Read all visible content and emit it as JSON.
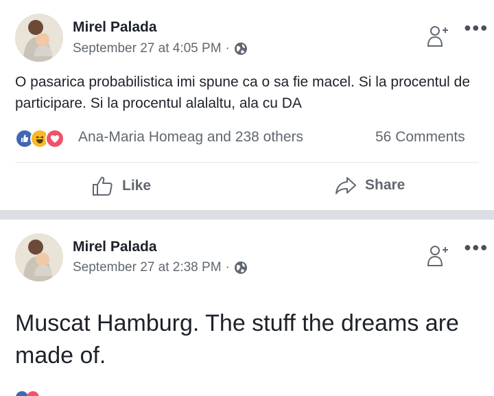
{
  "posts": [
    {
      "author": "Mirel Palada",
      "timestamp": "September 27 at 4:05 PM",
      "separator": "·",
      "privacy_icon": "globe-icon",
      "text": "O pasarica probabilistica imi spune ca o sa fie macel. Si la procentul de participare. Si la procentul alalaltu, ala cu DA",
      "reactions": [
        "like-icon",
        "haha-icon",
        "love-icon"
      ],
      "reactors": "Ana-Maria Homeag and 238 others",
      "comments": "56 Comments",
      "actions": {
        "like": "Like",
        "share": "Share"
      }
    },
    {
      "author": "Mirel Palada",
      "timestamp": "September 27 at 2:38 PM",
      "separator": "·",
      "privacy_icon": "globe-icon",
      "text": "Muscat Hamburg. The stuff the dreams are made of."
    }
  ],
  "colors": {
    "like_blue": "#4267b2",
    "haha_yellow": "#f7b928",
    "love_red": "#f25268",
    "meta_gray": "#616770",
    "divider": "#dcdee3"
  }
}
